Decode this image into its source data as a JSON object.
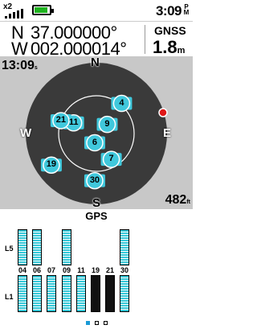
{
  "status": {
    "sat_count": "x2",
    "time": "3:09",
    "ampm": "P\nM",
    "battery_color": "#1fb31f"
  },
  "position": {
    "lat_hem": "N",
    "lat_value": "37.000000°",
    "lon_hem": "W",
    "lon_value": "002.000014°",
    "mode_label": "GNSS",
    "accuracy_value": "1.8",
    "accuracy_unit": "m"
  },
  "sky": {
    "time": "13:09",
    "time_unit": "s",
    "elevation": "482",
    "elevation_unit": "ft",
    "compass": {
      "n": "N",
      "s": "S",
      "e": "E",
      "w": "W"
    },
    "satellites": [
      {
        "prn": "4",
        "azimuth": 40,
        "elevation_deg": 40
      },
      {
        "prn": "9",
        "azimuth": 50,
        "elevation_deg": 72
      },
      {
        "prn": "11",
        "azimuth": 295,
        "elevation_deg": 58
      },
      {
        "prn": "21",
        "azimuth": 290,
        "elevation_deg": 42
      },
      {
        "prn": "6",
        "azimuth": 190,
        "elevation_deg": 78
      },
      {
        "prn": "7",
        "azimuth": 150,
        "elevation_deg": 52
      },
      {
        "prn": "19",
        "azimuth": 235,
        "elevation_deg": 20
      },
      {
        "prn": "30",
        "azimuth": 182,
        "elevation_deg": 30
      }
    ],
    "sat_color": "#40c8dc",
    "sbas_dot_color": "#e01818"
  },
  "gps": {
    "title": "GPS",
    "band_l5": "L5",
    "band_l1": "L1",
    "bars": [
      {
        "prn": "04",
        "l5": 0.64,
        "l1": 0.73,
        "dark": false
      },
      {
        "prn": "06",
        "l5": 0.64,
        "l1": 0.73,
        "dark": false
      },
      {
        "prn": "07",
        "l5": 0,
        "l1": 0.73,
        "dark": false
      },
      {
        "prn": "09",
        "l5": 0.64,
        "l1": 0.73,
        "dark": false
      },
      {
        "prn": "11",
        "l5": 0,
        "l1": 0.73,
        "dark": false
      },
      {
        "prn": "19",
        "l5": 0,
        "l1": 0.73,
        "dark": true
      },
      {
        "prn": "21",
        "l5": 0,
        "l1": 0.73,
        "dark": true
      },
      {
        "prn": "30",
        "l5": 0.64,
        "l1": 0.73,
        "dark": false
      }
    ],
    "page_count": 3,
    "page_active": 0
  }
}
